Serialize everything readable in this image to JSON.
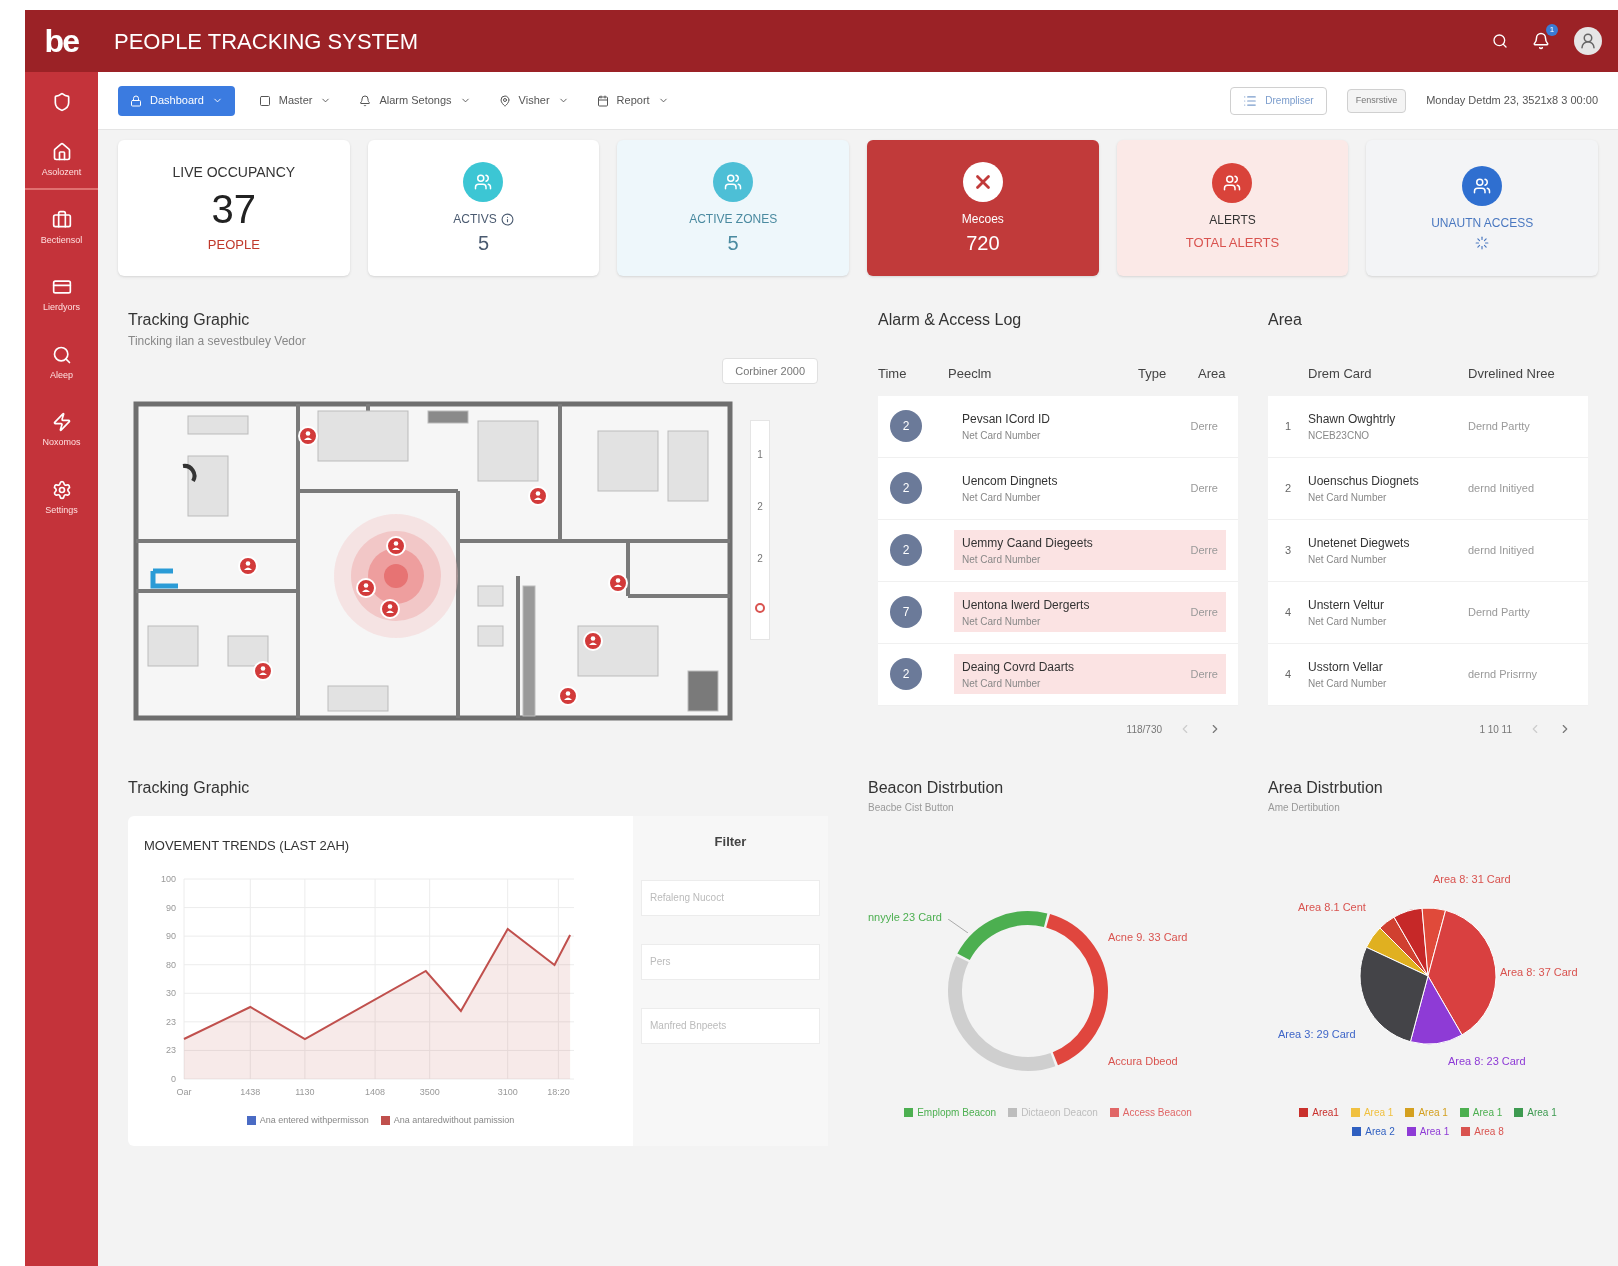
{
  "header": {
    "logo": "be",
    "title": "PEOPLE TRACKING SYSTEM",
    "notification_count": "1"
  },
  "sidebar": {
    "items": [
      {
        "selected": false
      },
      {
        "label": "Asolozent",
        "selected": true
      },
      {
        "label": "Bectiensol",
        "selected": false
      },
      {
        "label": "Lierdyors",
        "selected": false
      },
      {
        "label": "Aleep",
        "selected": false
      },
      {
        "label": "Noxomos",
        "selected": false
      },
      {
        "label": "Settings",
        "selected": false
      }
    ]
  },
  "toolbar": {
    "nav": [
      {
        "label": "Dashboard",
        "selected": true
      },
      {
        "label": "Master",
        "selected": false
      },
      {
        "label": "Alarm Setongs",
        "selected": false
      },
      {
        "label": "Visher",
        "selected": false
      },
      {
        "label": "Report",
        "selected": false
      }
    ],
    "view_button": "Drempliser",
    "small_button": "Fensrstive",
    "datetime": "Monday Detdm 23, 3521x8 3 00:00"
  },
  "stats": [
    {
      "kind": "plain",
      "label": "LIVE OCCUPANCY",
      "value": "37",
      "sub": "PEOPLE"
    },
    {
      "kind": "teal",
      "label": "ACTIVS",
      "value": "5"
    },
    {
      "kind": "sky",
      "label": "ACTIVE ZONES",
      "value": "5"
    },
    {
      "kind": "danger",
      "label": "Mecoes",
      "value": "720"
    },
    {
      "kind": "alert",
      "label": "ALERTS",
      "sub": "TOTAL ALERTS"
    },
    {
      "kind": "info",
      "label": "UNAUTN ACCESS"
    }
  ],
  "tracking": {
    "title": "Tracking Graphic",
    "subtitle": "Tincking ilan a sevestbuley Vedor",
    "dropdown": "Corbiner 2000",
    "floors": [
      "1",
      "2",
      "2"
    ]
  },
  "alarm_log": {
    "title": "Alarm & Access Log",
    "columns": [
      "Time",
      "Peeclm",
      "Type",
      "Area"
    ],
    "rows": [
      {
        "badge": "2",
        "name": "Pevsan ICord ID",
        "sub": "Net Card Number",
        "area": "Derre",
        "highlighted": false
      },
      {
        "badge": "2",
        "name": "Uencom Dingnets",
        "sub": "Net Card Number",
        "area": "Derre",
        "highlighted": false
      },
      {
        "badge": "2",
        "name": "Uemmy Caand Diegeets",
        "sub": "Net Card Number",
        "area": "Derre",
        "highlighted": true
      },
      {
        "badge": "7",
        "name": "Uentona Iwerd Dergerts",
        "sub": "Net Card Number",
        "area": "Derre",
        "highlighted": true
      },
      {
        "badge": "2",
        "name": "Deaing Covrd Daarts",
        "sub": "Net Card Number",
        "area": "Derre",
        "highlighted": true
      }
    ],
    "pagination": "118/730"
  },
  "area": {
    "title": "Area",
    "columns": [
      "Drem Card",
      "Dvrelined Nree"
    ],
    "rows": [
      {
        "index": "1",
        "name": "Shawn Owghtrly",
        "sub": "NCEB23CNO",
        "area": "Dernd Partty"
      },
      {
        "index": "2",
        "name": "Uoenschus Diognets",
        "sub": "Net Card Number",
        "area": "dernd Initiyed"
      },
      {
        "index": "3",
        "name": "Unetenet Diegwets",
        "sub": "Net Card Number",
        "area": "dernd Initiyed"
      },
      {
        "index": "4",
        "name": "Unstern Veltur",
        "sub": "Net Card Number",
        "area": "Dernd Partty"
      },
      {
        "index": "4",
        "name": "Usstorn Vellar",
        "sub": "Net Card Number",
        "area": "dernd Prisrrny"
      }
    ],
    "pagination": "1 10 11"
  },
  "movement": {
    "title": "Tracking Graphic",
    "chart_title": "MOVEMENT TRENDS (LAST 2AH)",
    "x_labels": [
      "Oar",
      "1438",
      "1130",
      "1408",
      "3500",
      "3100",
      "18:20"
    ],
    "y_labels": [
      "100",
      "90",
      "90",
      "80",
      "30",
      "23",
      "23",
      "0"
    ],
    "legend": [
      {
        "label": "Ana entered withpermisson",
        "color": "#4a6bc4"
      },
      {
        "label": "Ana antaredwithout pamission",
        "color": "#c0504d"
      }
    ],
    "filter": {
      "title": "Filter",
      "fields": [
        {
          "placeholder": "Refaleng Nucoct"
        },
        {
          "placeholder": "Pers"
        },
        {
          "placeholder": "Manfred Bnpeets"
        }
      ]
    }
  },
  "beacon": {
    "title": "Beacon Distrbution",
    "subtitle": "Beacbe Cist Button",
    "labels": [
      {
        "text": "nnyyle 23 Card",
        "color": "#4caf50"
      },
      {
        "text": "Acne 9. 33 Card",
        "color": "#d9534f"
      },
      {
        "text": "Accura Dbeod",
        "color": "#d9534f"
      }
    ],
    "legend": [
      {
        "label": "Emplopm Beacon",
        "color": "#4caf50"
      },
      {
        "label": "Dictaeon Deacon",
        "color": "#bdbdbd"
      },
      {
        "label": "Access Beacon",
        "color": "#e06666"
      }
    ]
  },
  "area_dist": {
    "title": "Area Distrbution",
    "subtitle": "Ame Dertibution",
    "labels": [
      {
        "text": "Area 8: 31 Card",
        "color": "#d9534f"
      },
      {
        "text": "Area 8.1 Cent",
        "color": "#d9534f"
      },
      {
        "text": "Area 8: 37 Card",
        "color": "#d9534f"
      },
      {
        "text": "Area 3: 29 Card",
        "color": "#3f66c8"
      },
      {
        "text": "Area 8: 23 Card",
        "color": "#8e3bd6"
      }
    ],
    "legend": [
      {
        "label": "Area1",
        "color": "#c9302c"
      },
      {
        "label": "Area 1",
        "color": "#f0c040"
      },
      {
        "label": "Area 1",
        "color": "#d4a020"
      },
      {
        "label": "Area 1",
        "color": "#4caf50"
      },
      {
        "label": "Area 1",
        "color": "#3d9a50"
      },
      {
        "label": "Area 2",
        "color": "#2f5fc0"
      },
      {
        "label": "Area 1",
        "color": "#8e3bd6"
      },
      {
        "label": "Area 8",
        "color": "#d9534f"
      }
    ]
  }
}
